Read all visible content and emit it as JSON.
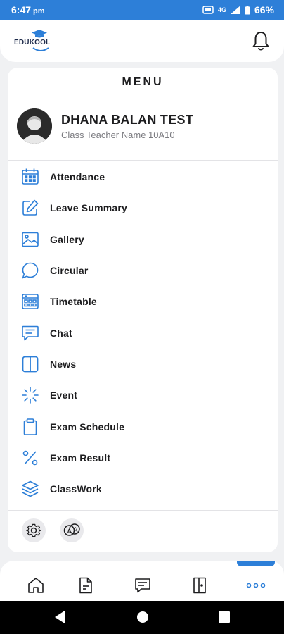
{
  "status_bar": {
    "time": "6:47",
    "ampm": "pm",
    "network": "4G",
    "battery": "66%"
  },
  "app": {
    "logo_text": "EDUKOOL",
    "brand_color": "#2d7fd8"
  },
  "menu": {
    "title": "MENU",
    "user": {
      "name": "DHANA BALAN TEST",
      "subtitle": "Class Teacher Name 10A10"
    },
    "items": [
      {
        "label": "Attendance",
        "icon": "calendar-icon"
      },
      {
        "label": "Leave Summary",
        "icon": "edit-icon"
      },
      {
        "label": "Gallery",
        "icon": "image-icon"
      },
      {
        "label": "Circular",
        "icon": "speech-bubble-icon"
      },
      {
        "label": "Timetable",
        "icon": "timetable-icon"
      },
      {
        "label": "Chat",
        "icon": "chat-icon"
      },
      {
        "label": "News",
        "icon": "news-icon"
      },
      {
        "label": "Event",
        "icon": "loader-icon"
      },
      {
        "label": "Exam Schedule",
        "icon": "clipboard-icon"
      },
      {
        "label": "Exam Result",
        "icon": "percent-icon"
      },
      {
        "label": "ClassWork",
        "icon": "layers-icon"
      }
    ],
    "footer_icons": [
      "settings-icon",
      "translate-icon"
    ]
  },
  "bottom_nav": {
    "items": [
      "home-icon",
      "document-icon",
      "message-icon",
      "door-icon",
      "more-icon"
    ],
    "active": "more-icon"
  }
}
